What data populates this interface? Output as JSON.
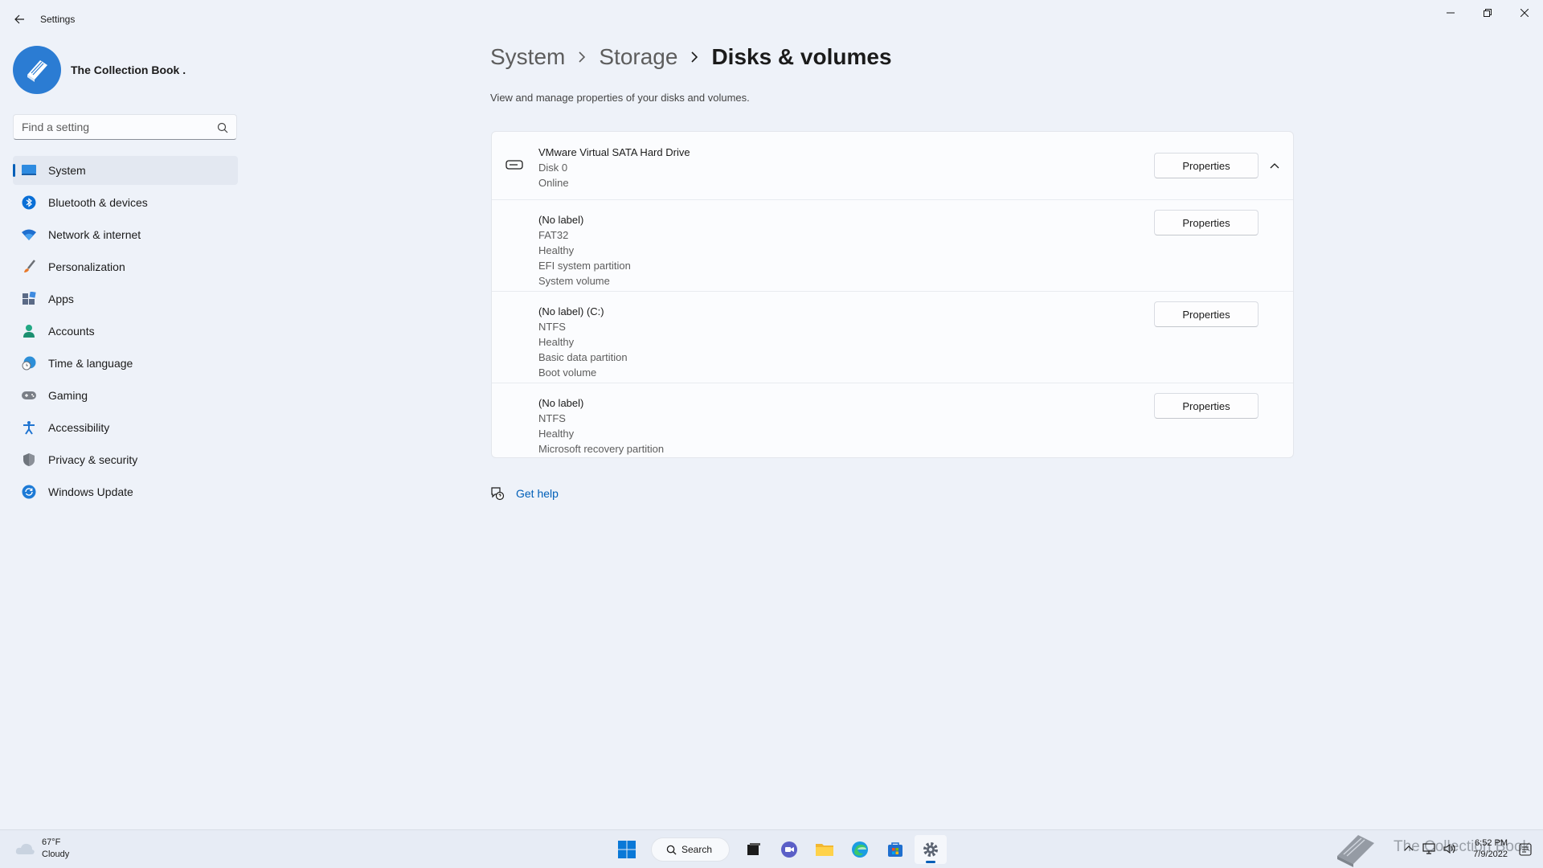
{
  "app": {
    "title": "Settings",
    "user_name": "The Collection Book ."
  },
  "search": {
    "placeholder": "Find a setting"
  },
  "sidebar": {
    "items": [
      {
        "label": "System",
        "icon": "system-icon",
        "active": true
      },
      {
        "label": "Bluetooth & devices",
        "icon": "bluetooth-icon"
      },
      {
        "label": "Network & internet",
        "icon": "wifi-icon"
      },
      {
        "label": "Personalization",
        "icon": "brush-icon"
      },
      {
        "label": "Apps",
        "icon": "apps-icon"
      },
      {
        "label": "Accounts",
        "icon": "person-icon"
      },
      {
        "label": "Time & language",
        "icon": "clock-globe-icon"
      },
      {
        "label": "Gaming",
        "icon": "gamepad-icon"
      },
      {
        "label": "Accessibility",
        "icon": "accessibility-icon"
      },
      {
        "label": "Privacy & security",
        "icon": "shield-icon"
      },
      {
        "label": "Windows Update",
        "icon": "update-icon"
      }
    ]
  },
  "breadcrumb": {
    "items": [
      "System",
      "Storage"
    ],
    "current": "Disks & volumes"
  },
  "page": {
    "subtitle": "View and manage properties of your disks and volumes."
  },
  "disk": {
    "name": "VMware Virtual SATA Hard Drive",
    "number": "Disk 0",
    "status": "Online",
    "button": "Properties"
  },
  "volumes": [
    {
      "label": "(No label)",
      "lines": [
        "FAT32",
        "Healthy",
        "EFI system partition",
        "System volume"
      ],
      "button": "Properties"
    },
    {
      "label": "(No label) (C:)",
      "lines": [
        "NTFS",
        "Healthy",
        "Basic data partition",
        "Boot volume"
      ],
      "button": "Properties"
    },
    {
      "label": "(No label)",
      "lines": [
        "NTFS",
        "Healthy",
        "Microsoft recovery partition"
      ],
      "button": "Properties"
    }
  ],
  "help": {
    "label": "Get help"
  },
  "taskbar": {
    "weather_temp": "67°F",
    "weather_desc": "Cloudy",
    "search_label": "Search",
    "time": "6:52 PM",
    "date": "7/9/2022",
    "watermark": "The Collection Book"
  },
  "colors": {
    "accent": "#005fb8",
    "background": "#eef2f9",
    "card": "#fbfcfe"
  }
}
